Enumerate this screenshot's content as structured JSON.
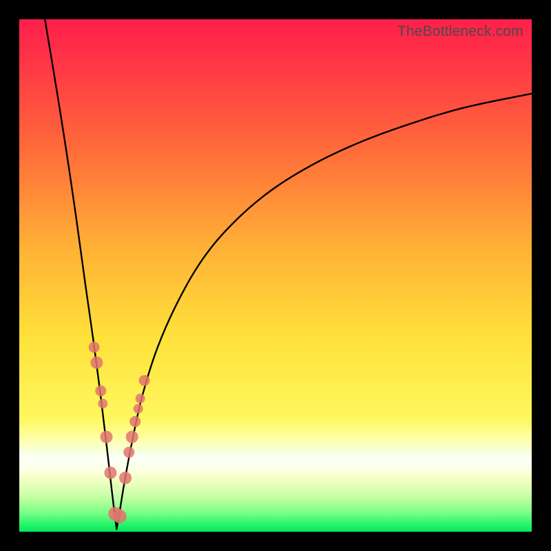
{
  "watermark": "TheBottleneck.com",
  "colors": {
    "frame": "#000000",
    "curve": "#000000",
    "marker_fill": "#e2746f",
    "marker_stroke": "#c9534f",
    "gradient_stops": [
      {
        "offset": 0.0,
        "color": "#ff1f4b"
      },
      {
        "offset": 0.1,
        "color": "#ff3a45"
      },
      {
        "offset": 0.25,
        "color": "#ff6a3a"
      },
      {
        "offset": 0.45,
        "color": "#ffb236"
      },
      {
        "offset": 0.62,
        "color": "#ffe13a"
      },
      {
        "offset": 0.78,
        "color": "#fdf85e"
      },
      {
        "offset": 0.82,
        "color": "#feffa9"
      },
      {
        "offset": 0.845,
        "color": "#f6ffe0"
      },
      {
        "offset": 0.855,
        "color": "#fbfff8"
      },
      {
        "offset": 0.87,
        "color": "#fcffee"
      },
      {
        "offset": 0.885,
        "color": "#fcffda"
      },
      {
        "offset": 0.9,
        "color": "#f0ffc1"
      },
      {
        "offset": 0.92,
        "color": "#d8ffb2"
      },
      {
        "offset": 0.94,
        "color": "#b4ff9c"
      },
      {
        "offset": 0.965,
        "color": "#74ff86"
      },
      {
        "offset": 0.985,
        "color": "#27f46a"
      },
      {
        "offset": 1.0,
        "color": "#05e85c"
      }
    ]
  },
  "chart_data": {
    "type": "line",
    "title": "",
    "xlabel": "",
    "ylabel": "",
    "xlim": [
      0,
      100
    ],
    "ylim": [
      0,
      100
    ],
    "notch_x": 19,
    "series": [
      {
        "name": "left-branch",
        "x": [
          5,
          7,
          9,
          11,
          13,
          14.5,
          16,
          17.2,
          18,
          18.6,
          19
        ],
        "y": [
          100,
          88,
          75.5,
          62,
          47.5,
          37,
          25.5,
          15.5,
          8.5,
          3.5,
          0.5
        ]
      },
      {
        "name": "right-branch",
        "x": [
          19,
          19.6,
          20.5,
          22,
          24,
          27,
          31,
          36,
          42,
          49,
          57,
          66,
          76,
          87,
          100
        ],
        "y": [
          0.5,
          4,
          9.5,
          17.5,
          26.5,
          36,
          45,
          53.5,
          60.5,
          66.5,
          71.5,
          75.8,
          79.5,
          82.8,
          85.5
        ]
      }
    ],
    "markers": {
      "name": "highlighted-points",
      "x": [
        14.6,
        15.1,
        15.9,
        16.3,
        17.0,
        17.8,
        18.7,
        19.6,
        20.7,
        21.4,
        22.0,
        22.6,
        23.2,
        23.6,
        24.4
      ],
      "y": [
        36.0,
        33.0,
        27.5,
        25.0,
        18.5,
        11.5,
        3.5,
        3.0,
        10.5,
        15.5,
        18.5,
        21.5,
        24.0,
        26.0,
        29.5
      ],
      "r": [
        8,
        9,
        8,
        7,
        9,
        9,
        10,
        10,
        9,
        8,
        9,
        8,
        7,
        7,
        8
      ]
    }
  }
}
